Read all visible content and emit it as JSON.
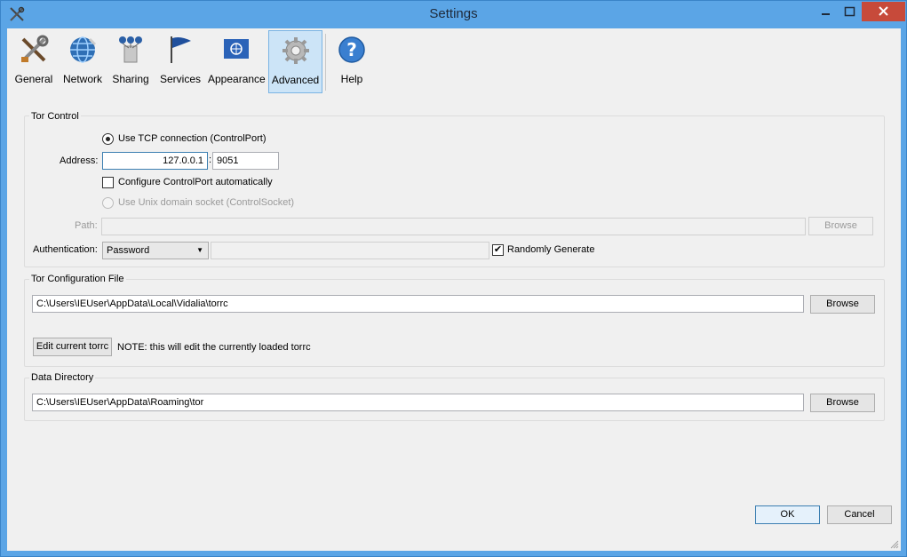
{
  "window": {
    "title": "Settings"
  },
  "toolbar": {
    "items": [
      {
        "label": "General",
        "icon": "tools-icon"
      },
      {
        "label": "Network",
        "icon": "network-globe-icon"
      },
      {
        "label": "Sharing",
        "icon": "sharing-relay-icon"
      },
      {
        "label": "Services",
        "icon": "services-flag-icon"
      },
      {
        "label": "Appearance",
        "icon": "appearance-flag-icon"
      },
      {
        "label": "Advanced",
        "icon": "gear-icon",
        "active": true
      },
      {
        "label": "Help",
        "icon": "help-icon"
      }
    ]
  },
  "tor_control": {
    "title": "Tor Control",
    "use_tcp_label": "Use TCP connection (ControlPort)",
    "address_label": "Address:",
    "address_value": "127.0.0.1",
    "colon": ":",
    "port_value": "9051",
    "configure_auto_label": "Configure ControlPort automatically",
    "use_unix_label": "Use Unix domain socket (ControlSocket)",
    "path_label": "Path:",
    "path_value": "",
    "browse_label": "Browse",
    "auth_label": "Authentication:",
    "auth_value": "Password",
    "password_value": "",
    "randomly_generate_label": "Randomly Generate",
    "randomly_generate_checked": true
  },
  "torrc": {
    "title": "Tor Configuration File",
    "path_value": "C:\\Users\\IEUser\\AppData\\Local\\Vidalia\\torrc",
    "browse_label": "Browse",
    "edit_button_label": "Edit current torrc",
    "note": "NOTE: this will edit the currently loaded torrc"
  },
  "data_directory": {
    "title": "Data Directory",
    "path_value": "C:\\Users\\IEUser\\AppData\\Roaming\\tor",
    "browse_label": "Browse"
  },
  "footer": {
    "ok_label": "OK",
    "cancel_label": "Cancel"
  },
  "colors": {
    "titlebar": "#5ba5e6",
    "close": "#c74a3a",
    "active_tab": "#cce4f7"
  }
}
